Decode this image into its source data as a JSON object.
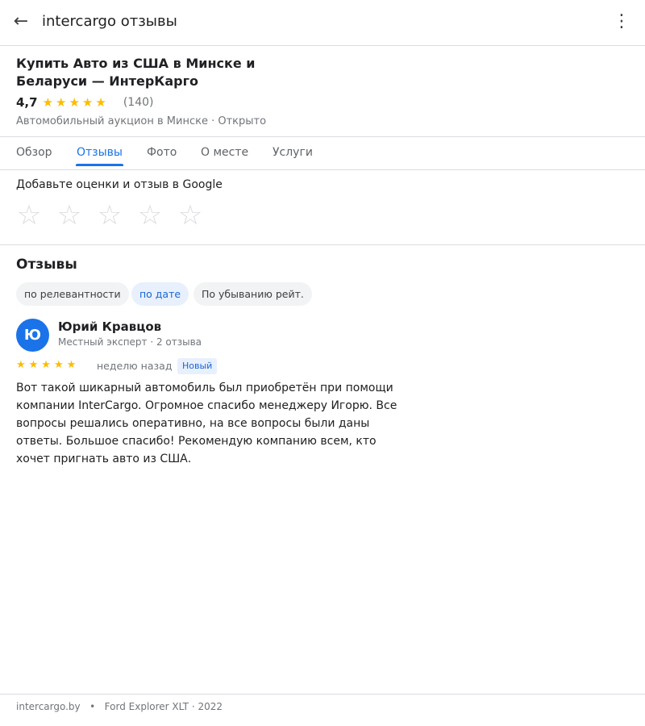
{
  "topbar": {
    "back_glyph": "←",
    "query": "intercargo отзывы",
    "more_glyph": "⋮"
  },
  "place": {
    "title": "Купить Авто из США в Минске и Беларуси — ИнтерКарго",
    "rating": "4,7",
    "stars": "★★★★★",
    "review_count": "(140)",
    "subtitle": "Автомобильный аукцион в Минске · Открыто"
  },
  "tabs": [
    {
      "label": "Обзор",
      "active": false
    },
    {
      "label": "Отзывы",
      "active": true
    },
    {
      "label": "Фото",
      "active": false
    },
    {
      "label": "О месте",
      "active": false
    },
    {
      "label": "Услуги",
      "active": false
    }
  ],
  "rate": {
    "prompt": "Добавьте оценки и отзыв в Google",
    "empty_star": "☆",
    "max_stars": 5
  },
  "reviews": {
    "title": "Отзывы",
    "sort_chips": [
      {
        "label": "по релевантности",
        "active": false
      },
      {
        "label": "по дате",
        "active": true
      },
      {
        "label": "По убыванию рейт.",
        "active": false
      }
    ],
    "items": [
      {
        "avatar_letter": "Ю",
        "author": "Юрий Кравцов",
        "author_meta": "Местный эксперт · 2 отзыва",
        "stars": "★★★★★",
        "rating_value": 5,
        "time": "неделю назад",
        "badge": "Новый",
        "text": "Вот такой шикарный автомобиль был приобретён при помощи компании InterCargo. Огромное спасибо менеджеру Игорю. Все вопросы решались оперативно, на все вопросы были даны ответы. Большое спасибо! Рекомендую компанию всем, кто хочет пригнать авто из США."
      }
    ]
  },
  "footer": {
    "site": "intercargo.by",
    "separator": "•",
    "caption": "Ford Explorer XLT · 2022"
  },
  "colors": {
    "accent": "#1a73e8",
    "star": "#fbbc04",
    "divider": "#dadce0",
    "muted_text": "#70757a"
  }
}
